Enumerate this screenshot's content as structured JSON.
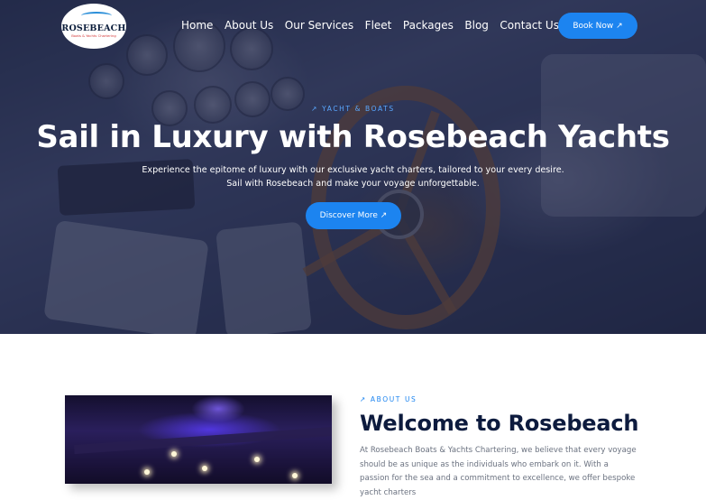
{
  "colors": {
    "accent": "#1c84f0",
    "heading": "#0d1b3e",
    "body_text": "#6b7280",
    "hero_overlay": "#1c2246"
  },
  "logo": {
    "title": "ROSEBEACH",
    "subtitle": "Boats & Yachts Chartering"
  },
  "nav": {
    "items": [
      {
        "label": "Home"
      },
      {
        "label": "About Us"
      },
      {
        "label": "Our Services"
      },
      {
        "label": "Fleet"
      },
      {
        "label": "Packages"
      },
      {
        "label": "Blog"
      },
      {
        "label": "Contact Us"
      }
    ],
    "cta_label": "Book Now ↗"
  },
  "hero": {
    "eyebrow": "↗ YACHT & BOATS",
    "title": "Sail in Luxury with Rosebeach Yachts",
    "subtitle_line1": "Experience the epitome of luxury with our exclusive yacht charters, tailored to your every desire.",
    "subtitle_line2": "Sail with Rosebeach and make your voyage unforgettable.",
    "cta_label": "Discover More ↗"
  },
  "about": {
    "eyebrow": "↗ ABOUT US",
    "title": "Welcome to Rosebeach",
    "text": "At Rosebeach Boats & Yachts Chartering, we believe that every voyage should be as unique as the individuals who embark on it. With a passion for the sea and a commitment to excellence, we offer bespoke yacht charters"
  }
}
